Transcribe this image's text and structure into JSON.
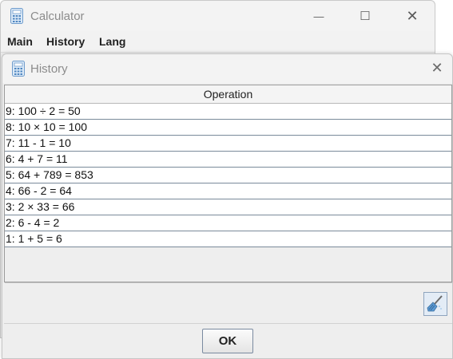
{
  "main_window": {
    "title": "Calculator",
    "controls": {
      "minimize": "—",
      "maximize": "☐",
      "close": "✕"
    },
    "menu": [
      "Main",
      "History",
      "Lang"
    ]
  },
  "dialog": {
    "title": "History",
    "close": "✕",
    "table": {
      "column": "Operation",
      "rows": [
        "9: 100 ÷ 2 = 50",
        "8: 10 × 10 = 100",
        "7: 11 - 1 = 10",
        "6: 4 + 7 = 11",
        "5: 64 + 789 = 853",
        "4: 66 - 2 = 64",
        "3: 2 × 33 = 66",
        "2: 6 - 4 = 2",
        "1: 1 + 5 = 6"
      ]
    },
    "clear_icon": "broom-icon",
    "ok_label": "OK"
  },
  "colors": {
    "window_bg": "#eeeeee",
    "titlebar_bg": "#f3f3f3",
    "row_border": "#7a8a9a",
    "accent_button_bg": "#e3ecf6"
  }
}
